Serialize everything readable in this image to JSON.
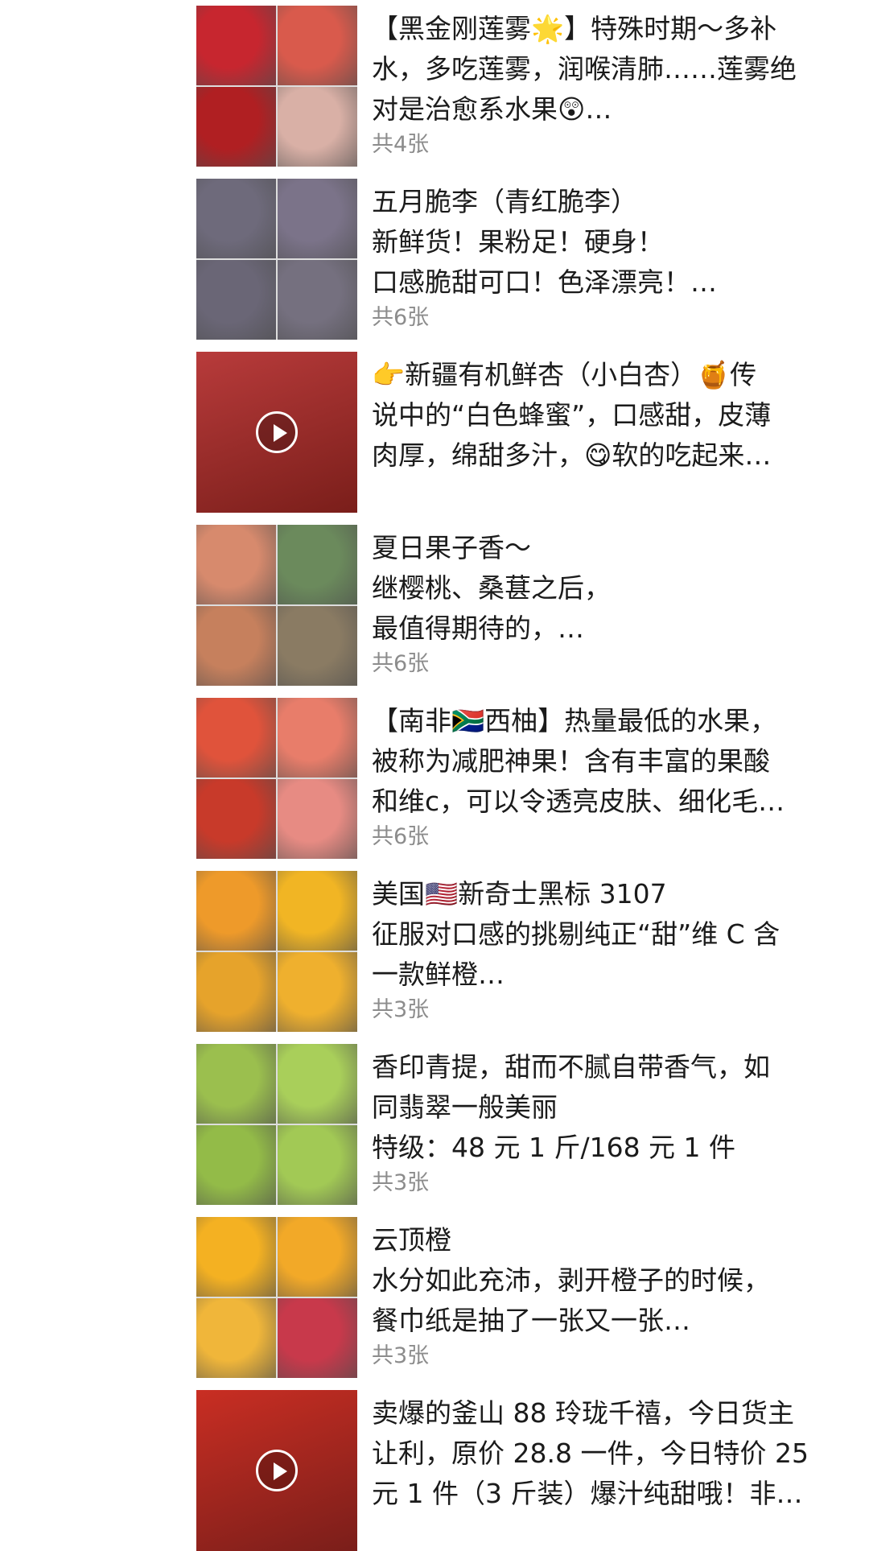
{
  "posts": [
    {
      "lines": [
        "【黑金刚莲雾🌟】特殊时期～多补",
        "水，多吃莲雾，润喉清肺……莲雾绝",
        "对是治愈系水果😲…"
      ],
      "count": "共4张",
      "video": false,
      "colors": [
        "#c7262f",
        "#d95a4c",
        "#b01f22",
        "#d9b0a6"
      ]
    },
    {
      "lines": [
        "五月脆李（青红脆李）",
        "新鲜货！果粉足！硬身！",
        "口感脆甜可口！色泽漂亮！…"
      ],
      "count": "共6张",
      "video": false,
      "colors": [
        "#6e6a7b",
        "#7b7389",
        "#6a6676",
        "#75707f"
      ]
    },
    {
      "lines": [
        "👉新疆有机鲜杏（小白杏）🍯传",
        "说中的“白色蜂蜜”，口感甜，皮薄",
        "肉厚，绵甜多汁，😋软的吃起来…"
      ],
      "count": "",
      "video": true,
      "colors": [
        "#b83b3b"
      ]
    },
    {
      "lines": [
        "夏日果子香～",
        "继樱桃、桑葚之后，",
        "最值得期待的，…"
      ],
      "count": "共6张",
      "video": false,
      "colors": [
        "#d78a6d",
        "#6b8a5c",
        "#c6805d",
        "#8a7b63"
      ]
    },
    {
      "lines": [
        "【南非🇿🇦西柚】热量最低的水果，",
        "被称为减肥神果！含有丰富的果酸",
        "和维c，可以令透亮皮肤、细化毛…"
      ],
      "count": "共6张",
      "video": false,
      "colors": [
        "#e0533b",
        "#e87d6a",
        "#c83a2a",
        "#e78b83"
      ]
    },
    {
      "lines": [
        "美国🇺🇸新奇士黑标 3107",
        "征服对口感的挑剔纯正“甜”维 C 含",
        "一款鲜橙…"
      ],
      "count": "共3张",
      "video": false,
      "colors": [
        "#ee9a2a",
        "#f1b524",
        "#e6a32b",
        "#efb02e"
      ]
    },
    {
      "lines": [
        "香印青提，甜而不腻自带香气，如",
        "同翡翠一般美丽",
        "特级：48 元 1 斤/168 元 1 件"
      ],
      "count": "共3张",
      "video": false,
      "colors": [
        "#9bbf4e",
        "#a9cf5a",
        "#93bb48",
        "#a2c955"
      ]
    },
    {
      "lines": [
        "云顶橙",
        "水分如此充沛，剥开橙子的时候，",
        "餐巾纸是抽了一张又一张…"
      ],
      "count": "共3张",
      "video": false,
      "colors": [
        "#f4b122",
        "#f2a928",
        "#f0b63a",
        "#c8394b"
      ]
    },
    {
      "lines": [
        "卖爆的釜山 88 玲珑千禧，今日货主",
        "让利，原价 28.8 一件，今日特价 25",
        "元 1 件（3 斤装）爆汁纯甜哦！非…"
      ],
      "count": "",
      "video": true,
      "colors": [
        "#c92e23"
      ]
    }
  ]
}
